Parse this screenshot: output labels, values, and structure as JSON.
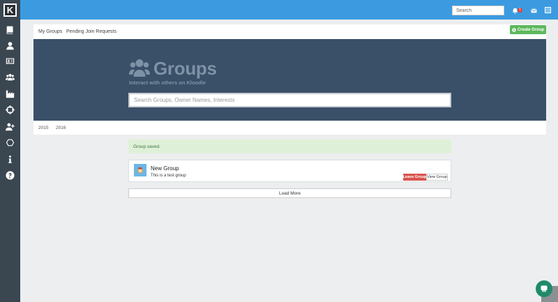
{
  "app": {
    "logo_text": "K",
    "colors": {
      "topbar": "#3c9be0",
      "sidebar": "#3a4650",
      "hero": "#3a5068",
      "success": "#5cb85c",
      "danger": "#d9534f",
      "alert_bg": "#dff0d8"
    }
  },
  "sidebar": {
    "items": [
      {
        "icon": "book-icon"
      },
      {
        "icon": "user-icon"
      },
      {
        "icon": "id-card-icon"
      },
      {
        "icon": "users-icon"
      },
      {
        "icon": "industry-icon"
      },
      {
        "icon": "crosshairs-icon"
      },
      {
        "icon": "user-plus-icon"
      },
      {
        "icon": "hexagon-icon"
      },
      {
        "icon": "info-icon"
      },
      {
        "icon": "help-icon"
      }
    ]
  },
  "topbar": {
    "search_placeholder": "Search",
    "notification_count": "1",
    "icons": [
      "bell-icon",
      "envelope-icon",
      "avatar"
    ]
  },
  "tabs": {
    "my_groups": "My Groups",
    "pending": "Pending Join Requests",
    "create_button": "Create Group"
  },
  "hero": {
    "title": "Groups",
    "subtitle": "Interact with others on Kloodle",
    "search_placeholder": "Search Groups, Owner Names, Interests"
  },
  "years": [
    "2015",
    "2016"
  ],
  "alert": {
    "text": "Group saved."
  },
  "groups": [
    {
      "title": "New Group",
      "description": "This is a test group",
      "leave_label": "Leave Group",
      "view_label": "View Group"
    }
  ],
  "load_more": "Load More"
}
